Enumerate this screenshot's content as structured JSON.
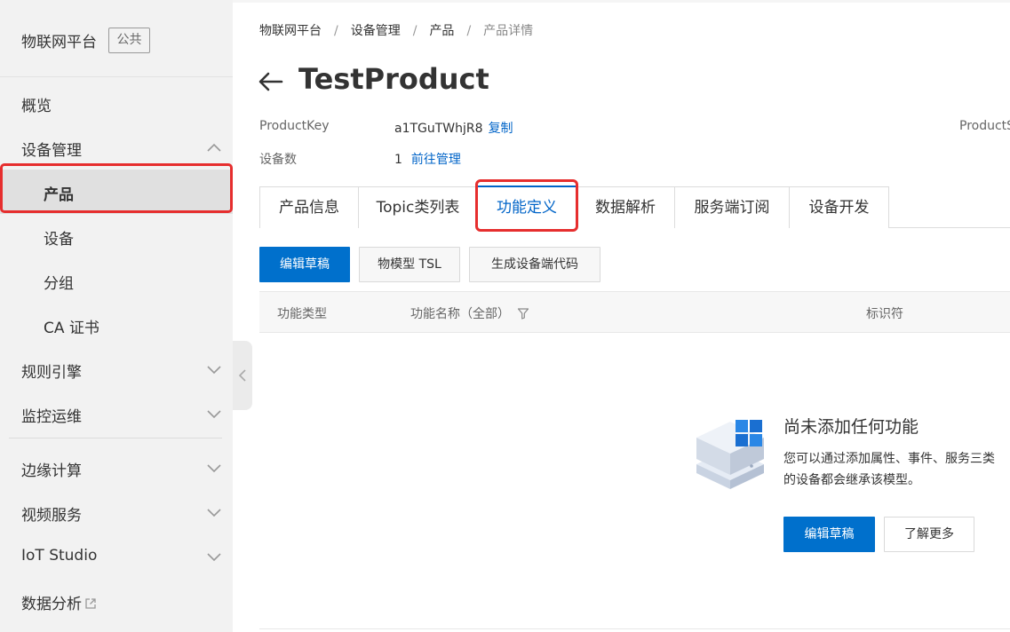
{
  "sidebar": {
    "title": "物联网平台",
    "badge": "公共",
    "items": [
      {
        "label": "概览"
      },
      {
        "label": "设备管理"
      },
      {
        "label": "产品"
      },
      {
        "label": "设备"
      },
      {
        "label": "分组"
      },
      {
        "label": "CA 证书"
      },
      {
        "label": "规则引擎"
      },
      {
        "label": "监控运维"
      },
      {
        "label": "边缘计算"
      },
      {
        "label": "视频服务"
      },
      {
        "label": "IoT Studio"
      },
      {
        "label": "数据分析"
      }
    ]
  },
  "breadcrumb": {
    "items": [
      "物联网平台",
      "设备管理",
      "产品",
      "产品详情"
    ],
    "separator": "/"
  },
  "page": {
    "title": "TestProduct"
  },
  "info": {
    "product_key_label": "ProductKey",
    "product_key_value": "a1TGuTWhjR8",
    "copy_link": "复制",
    "device_count_label": "设备数",
    "device_count_value": "1",
    "manage_link": "前往管理",
    "product_secret_label": "ProductS"
  },
  "tabs": [
    {
      "label": "产品信息"
    },
    {
      "label": "Topic类列表"
    },
    {
      "label": "功能定义"
    },
    {
      "label": "数据解析"
    },
    {
      "label": "服务端订阅"
    },
    {
      "label": "设备开发"
    }
  ],
  "toolbar": {
    "edit_draft": "编辑草稿",
    "tsl": "物模型 TSL",
    "generate_code": "生成设备端代码"
  },
  "table": {
    "columns": [
      "功能类型",
      "功能名称（全部）",
      "标识符"
    ]
  },
  "empty": {
    "title": "尚未添加任何功能",
    "desc_line1": "您可以通过添加属性、事件、服务三类",
    "desc_line2": "的设备都会继承该模型。",
    "edit_button": "编辑草稿",
    "learn_more": "了解更多"
  },
  "colors": {
    "primary": "#0070cc",
    "link": "#0064c8",
    "highlight": "#e62e2e",
    "accent": "#ff6a00"
  }
}
